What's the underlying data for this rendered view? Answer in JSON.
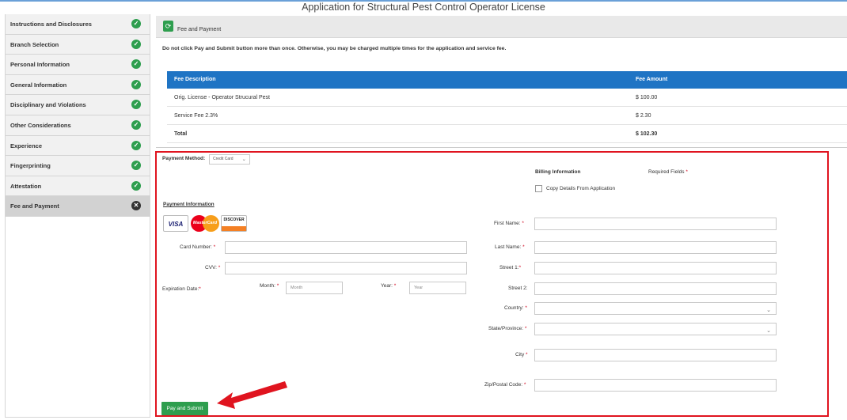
{
  "app": {
    "title": "Application for Structural Pest Control Operator License"
  },
  "sidebar": {
    "items": [
      {
        "label": "Instructions and Disclosures",
        "status": "complete"
      },
      {
        "label": "Branch Selection",
        "status": "complete"
      },
      {
        "label": "Personal Information",
        "status": "complete"
      },
      {
        "label": "General Information",
        "status": "complete"
      },
      {
        "label": "Disciplinary and Violations",
        "status": "complete"
      },
      {
        "label": "Other Considerations",
        "status": "complete"
      },
      {
        "label": "Experience",
        "status": "complete"
      },
      {
        "label": "Fingerprinting",
        "status": "complete"
      },
      {
        "label": "Attestation",
        "status": "complete"
      },
      {
        "label": "Fee and Payment",
        "status": "current"
      }
    ],
    "complete_glyph": "✓",
    "current_glyph": "✕"
  },
  "header": {
    "icon": "refresh-icon",
    "icon_glyph": "⟳",
    "label": "Fee and Payment"
  },
  "warning": "Do not click Pay and Submit button more than once. Otherwise, you may be charged multiple times for the application and service fee.",
  "fee_table": {
    "headers": [
      "Fee Description",
      "Fee Amount"
    ],
    "rows": [
      [
        "Orig. License - Operator Strucural Pest",
        "$ 100.00"
      ],
      [
        "Service Fee 2.3%",
        "$ 2.30"
      ]
    ],
    "total": [
      "Total",
      "$ 102.30"
    ]
  },
  "payment_method": {
    "label": "Payment Method:",
    "value": "Credit Card"
  },
  "billing": {
    "title": "Billing Information",
    "required_label": "Required Fields",
    "copy_label": "Copy Details From Application",
    "first_name": "First Name:",
    "last_name": "Last Name:",
    "street1": "Street 1:",
    "street2": "Street 2:",
    "country": "Country:",
    "state": "State/Province:",
    "city": "City",
    "zip": "Zip/Postal Code:"
  },
  "payment_info": {
    "title": "Payment Information",
    "cards": {
      "visa": "VISA",
      "mastercard": "MasterCard",
      "discover": "DISCOVER"
    },
    "card_number": "Card Number:",
    "cvv": "CVV:",
    "expiration": "Expiration Date:",
    "month_label": "Month:",
    "month_placeholder": "Month",
    "year_label": "Year:",
    "year_placeholder": "Year"
  },
  "required_marker": "*",
  "caret_glyph": "⌄",
  "submit": {
    "label": "Pay and Submit"
  },
  "colors": {
    "accent": "#1f74c4",
    "success": "#2e9e4e",
    "highlight": "#e0141f"
  }
}
